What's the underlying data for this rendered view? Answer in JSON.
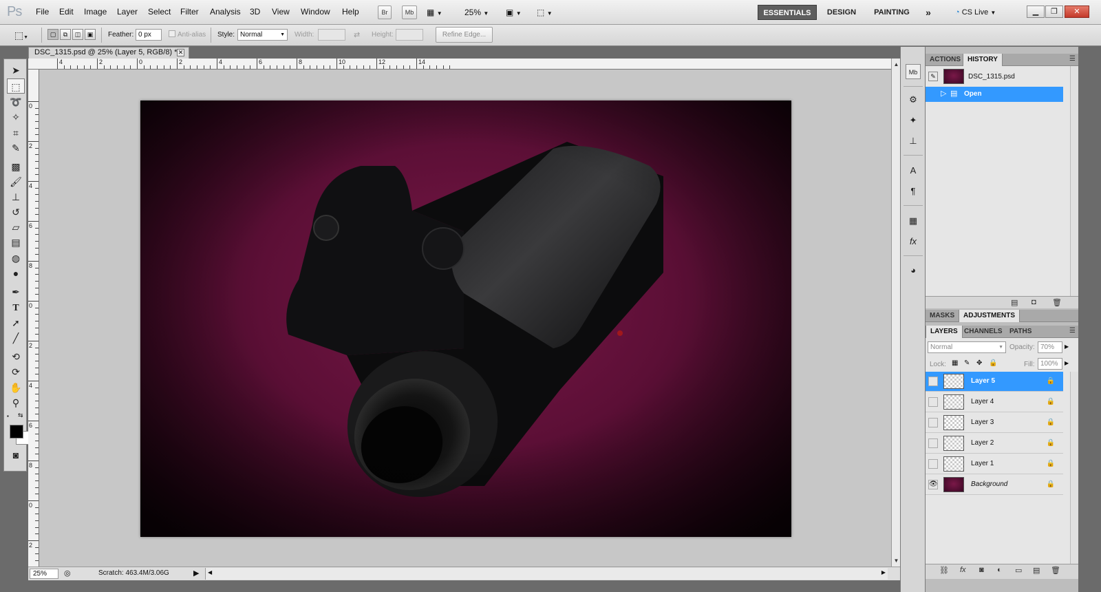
{
  "app": {
    "logo": "Ps"
  },
  "menu": [
    "File",
    "Edit",
    "Image",
    "Layer",
    "Select",
    "Filter",
    "Analysis",
    "3D",
    "View",
    "Window",
    "Help"
  ],
  "menubar": {
    "bridge_label": "Br",
    "minibridge_label": "Mb",
    "zoom_value": "25%",
    "workspaces": [
      "ESSENTIALS",
      "DESIGN",
      "PAINTING"
    ],
    "more_workspaces": "»",
    "cs_live": "CS Live"
  },
  "options": {
    "feather_label": "Feather:",
    "feather_value": "0 px",
    "antialias_label": "Anti-alias",
    "style_label": "Style:",
    "style_value": "Normal",
    "width_label": "Width:",
    "height_label": "Height:",
    "refine_edge_label": "Refine Edge..."
  },
  "document": {
    "tab_title": "DSC_1315.psd @ 25% (Layer 5, RGB/8) *",
    "zoom": "25%",
    "scratch": "Scratch: 463.4M/3.06G"
  },
  "rulers": {
    "h_labels": [
      "4",
      "2",
      "0",
      "2",
      "4",
      "6",
      "8",
      "10",
      "12",
      "14"
    ],
    "v_labels": [
      "0",
      "2",
      "4",
      "6",
      "8",
      "0",
      "2",
      "4",
      "6",
      "8",
      "0",
      "2"
    ]
  },
  "history_panel": {
    "tabs": [
      "ACTIONS",
      "HISTORY"
    ],
    "snapshot_name": "DSC_1315.psd",
    "states": [
      "Open"
    ]
  },
  "adjust_panel": {
    "tabs": [
      "MASKS",
      "ADJUSTMENTS"
    ]
  },
  "layers_panel": {
    "tabs": [
      "LAYERS",
      "CHANNELS",
      "PATHS"
    ],
    "blend_mode": "Normal",
    "opacity_label": "Opacity:",
    "opacity_value": "70%",
    "lock_label": "Lock:",
    "fill_label": "Fill:",
    "fill_value": "100%",
    "layers": [
      "Layer 5",
      "Layer 4",
      "Layer 3",
      "Layer 2",
      "Layer 1",
      "Background"
    ],
    "selected_layer": "Layer 5"
  },
  "colors": {
    "accent": "#3399ff",
    "photo": "#5c0f36"
  }
}
